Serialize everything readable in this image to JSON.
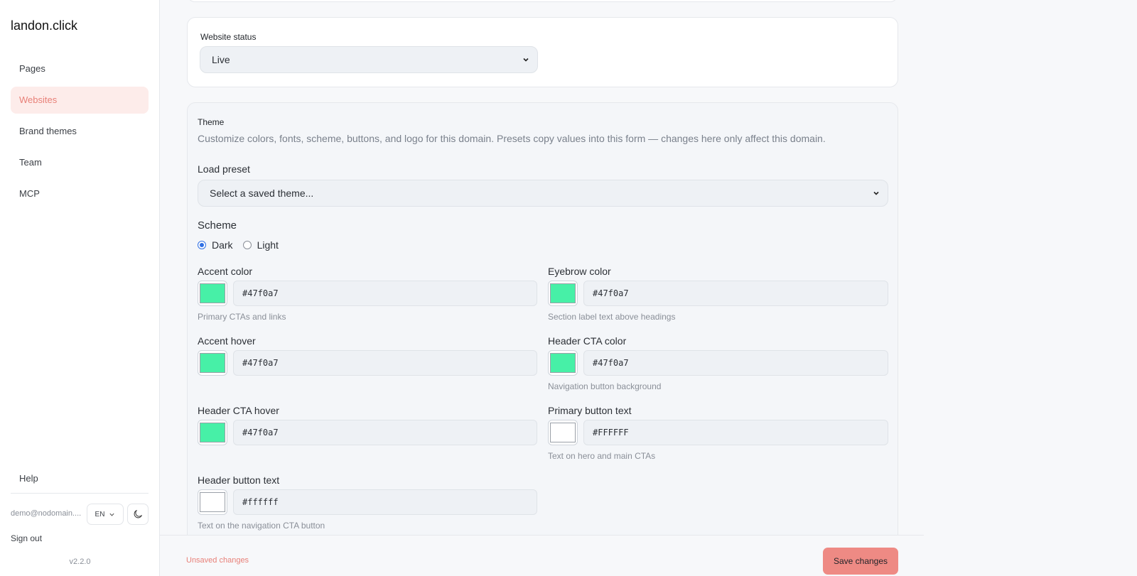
{
  "sidebar": {
    "logo": "landon.click",
    "items": [
      {
        "label": "Pages",
        "active": false
      },
      {
        "label": "Websites",
        "active": true
      },
      {
        "label": "Brand themes",
        "active": false
      },
      {
        "label": "Team",
        "active": false
      },
      {
        "label": "MCP",
        "active": false
      }
    ],
    "help": "Help",
    "user_email": "demo@nodomain....",
    "language": "EN",
    "sign_out": "Sign out",
    "version": "v2.2.0"
  },
  "status": {
    "label": "Website status",
    "value": "Live"
  },
  "theme": {
    "title": "Theme",
    "description": "Customize colors, fonts, scheme, buttons, and logo for this domain. Presets copy values into this form — changes here only affect this domain.",
    "preset_label": "Load preset",
    "preset_placeholder": "Select a saved theme...",
    "scheme_label": "Scheme",
    "scheme_options": [
      "Dark",
      "Light"
    ],
    "scheme_selected": "Dark",
    "colors": {
      "accent_color": {
        "label": "Accent color",
        "value": "#47f0a7",
        "hint": "Primary CTAs and links"
      },
      "eyebrow_color": {
        "label": "Eyebrow color",
        "value": "#47f0a7",
        "hint": "Section label text above headings"
      },
      "accent_hover": {
        "label": "Accent hover",
        "value": "#47f0a7",
        "hint": ""
      },
      "header_cta_color": {
        "label": "Header CTA color",
        "value": "#47f0a7",
        "hint": "Navigation button background"
      },
      "header_cta_hover": {
        "label": "Header CTA hover",
        "value": "#47f0a7",
        "hint": ""
      },
      "primary_button_text": {
        "label": "Primary button text",
        "value": "#FFFFFF",
        "hint": "Text on hero and main CTAs"
      },
      "header_button_text": {
        "label": "Header button text",
        "value": "#ffffff",
        "hint": "Text on the navigation CTA button"
      }
    }
  },
  "footer": {
    "unsaved": "Unsaved changes",
    "save_label": "Save changes"
  },
  "palette": {
    "brand_accent": "#ee8a84",
    "swatch_green": "#47f0a7"
  }
}
